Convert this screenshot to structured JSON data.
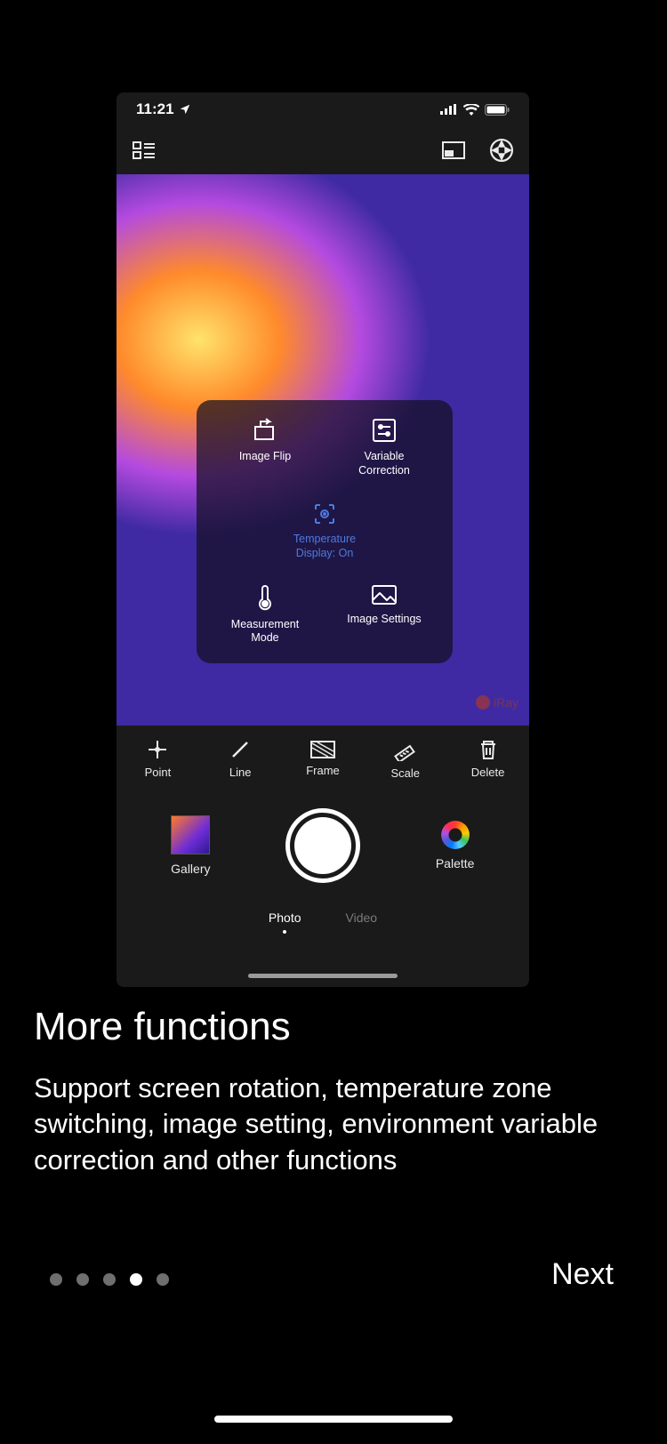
{
  "statusbar": {
    "time": "11:21"
  },
  "brand": "iRay",
  "panel": {
    "image_flip": "Image Flip",
    "variable_correction": "Variable\nCorrection",
    "center": "Temperature\nDisplay: On",
    "measurement_mode": "Measurement\nMode",
    "image_settings": "Image Settings"
  },
  "tools": {
    "point": "Point",
    "line": "Line",
    "frame": "Frame",
    "scale": "Scale",
    "delete": "Delete"
  },
  "capture": {
    "gallery": "Gallery",
    "palette": "Palette"
  },
  "modes": {
    "photo": "Photo",
    "video": "Video"
  },
  "onboarding": {
    "title": "More functions",
    "body": "Support screen rotation, temperature zone switching, image setting, environment variable correction and other functions",
    "next": "Next",
    "active_dot_index": 3,
    "dot_count": 5
  }
}
